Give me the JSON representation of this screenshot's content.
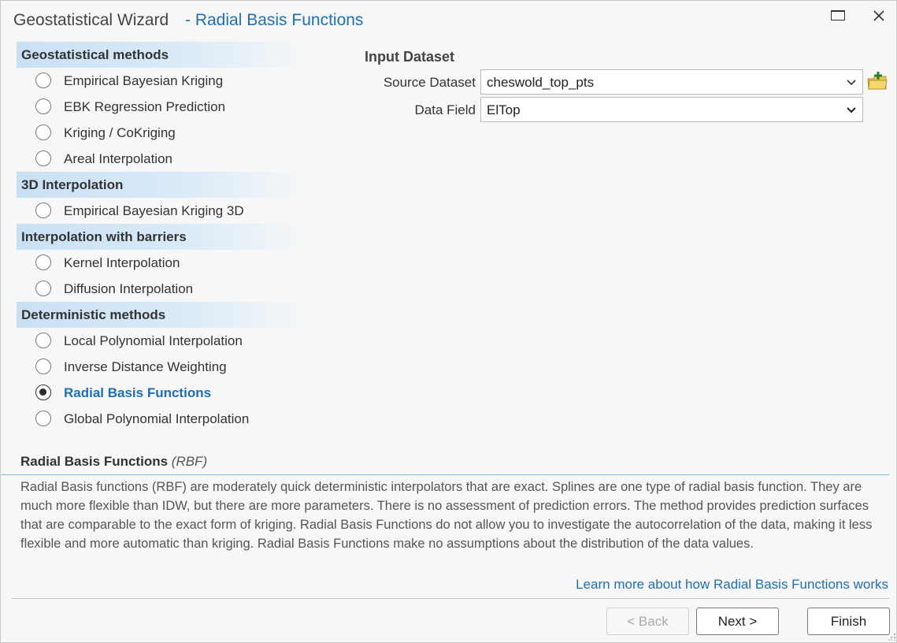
{
  "window": {
    "title": "Geostatistical Wizard",
    "subtitle": "- Radial Basis Functions",
    "maximize_icon": "maximize-icon",
    "close_icon": "close-icon"
  },
  "methods": {
    "groups": [
      {
        "header": "Geostatistical methods",
        "items": [
          {
            "label": "Empirical Bayesian Kriging",
            "selected": false
          },
          {
            "label": "EBK Regression Prediction",
            "selected": false
          },
          {
            "label": "Kriging / CoKriging",
            "selected": false
          },
          {
            "label": "Areal Interpolation",
            "selected": false
          }
        ]
      },
      {
        "header": "3D Interpolation",
        "items": [
          {
            "label": "Empirical Bayesian Kriging 3D",
            "selected": false
          }
        ]
      },
      {
        "header": "Interpolation with barriers",
        "items": [
          {
            "label": "Kernel Interpolation",
            "selected": false
          },
          {
            "label": "Diffusion Interpolation",
            "selected": false
          }
        ]
      },
      {
        "header": "Deterministic methods",
        "items": [
          {
            "label": "Local Polynomial Interpolation",
            "selected": false
          },
          {
            "label": "Inverse Distance Weighting",
            "selected": false
          },
          {
            "label": "Radial Basis Functions",
            "selected": true
          },
          {
            "label": "Global Polynomial Interpolation",
            "selected": false
          }
        ]
      }
    ]
  },
  "input": {
    "heading": "Input Dataset",
    "source_label": "Source Dataset",
    "source_value": "cheswold_top_pts",
    "field_label": "Data Field",
    "field_value": "ElTop",
    "add_data_icon": "add-data-icon"
  },
  "description": {
    "title": "Radial Basis Functions",
    "abbrev": "(RBF)",
    "text": "Radial Basis functions (RBF) are moderately quick deterministic interpolators that are exact. Splines are one type of radial basis function. They are much more flexible than IDW, but there are more parameters. There is no assessment of prediction errors. The method provides prediction surfaces that are comparable to the exact form of kriging. Radial Basis Functions do not allow you to investigate the autocorrelation of the data, making it less flexible and more automatic than kriging. Radial Basis Functions make no assumptions about the distribution of the data values.",
    "link": "Learn more about how Radial Basis Functions works"
  },
  "buttons": {
    "back": "< Back",
    "next": "Next >",
    "finish": "Finish"
  },
  "colors": {
    "accent": "#1e6fb5",
    "header_band": "#c9e0f4"
  }
}
